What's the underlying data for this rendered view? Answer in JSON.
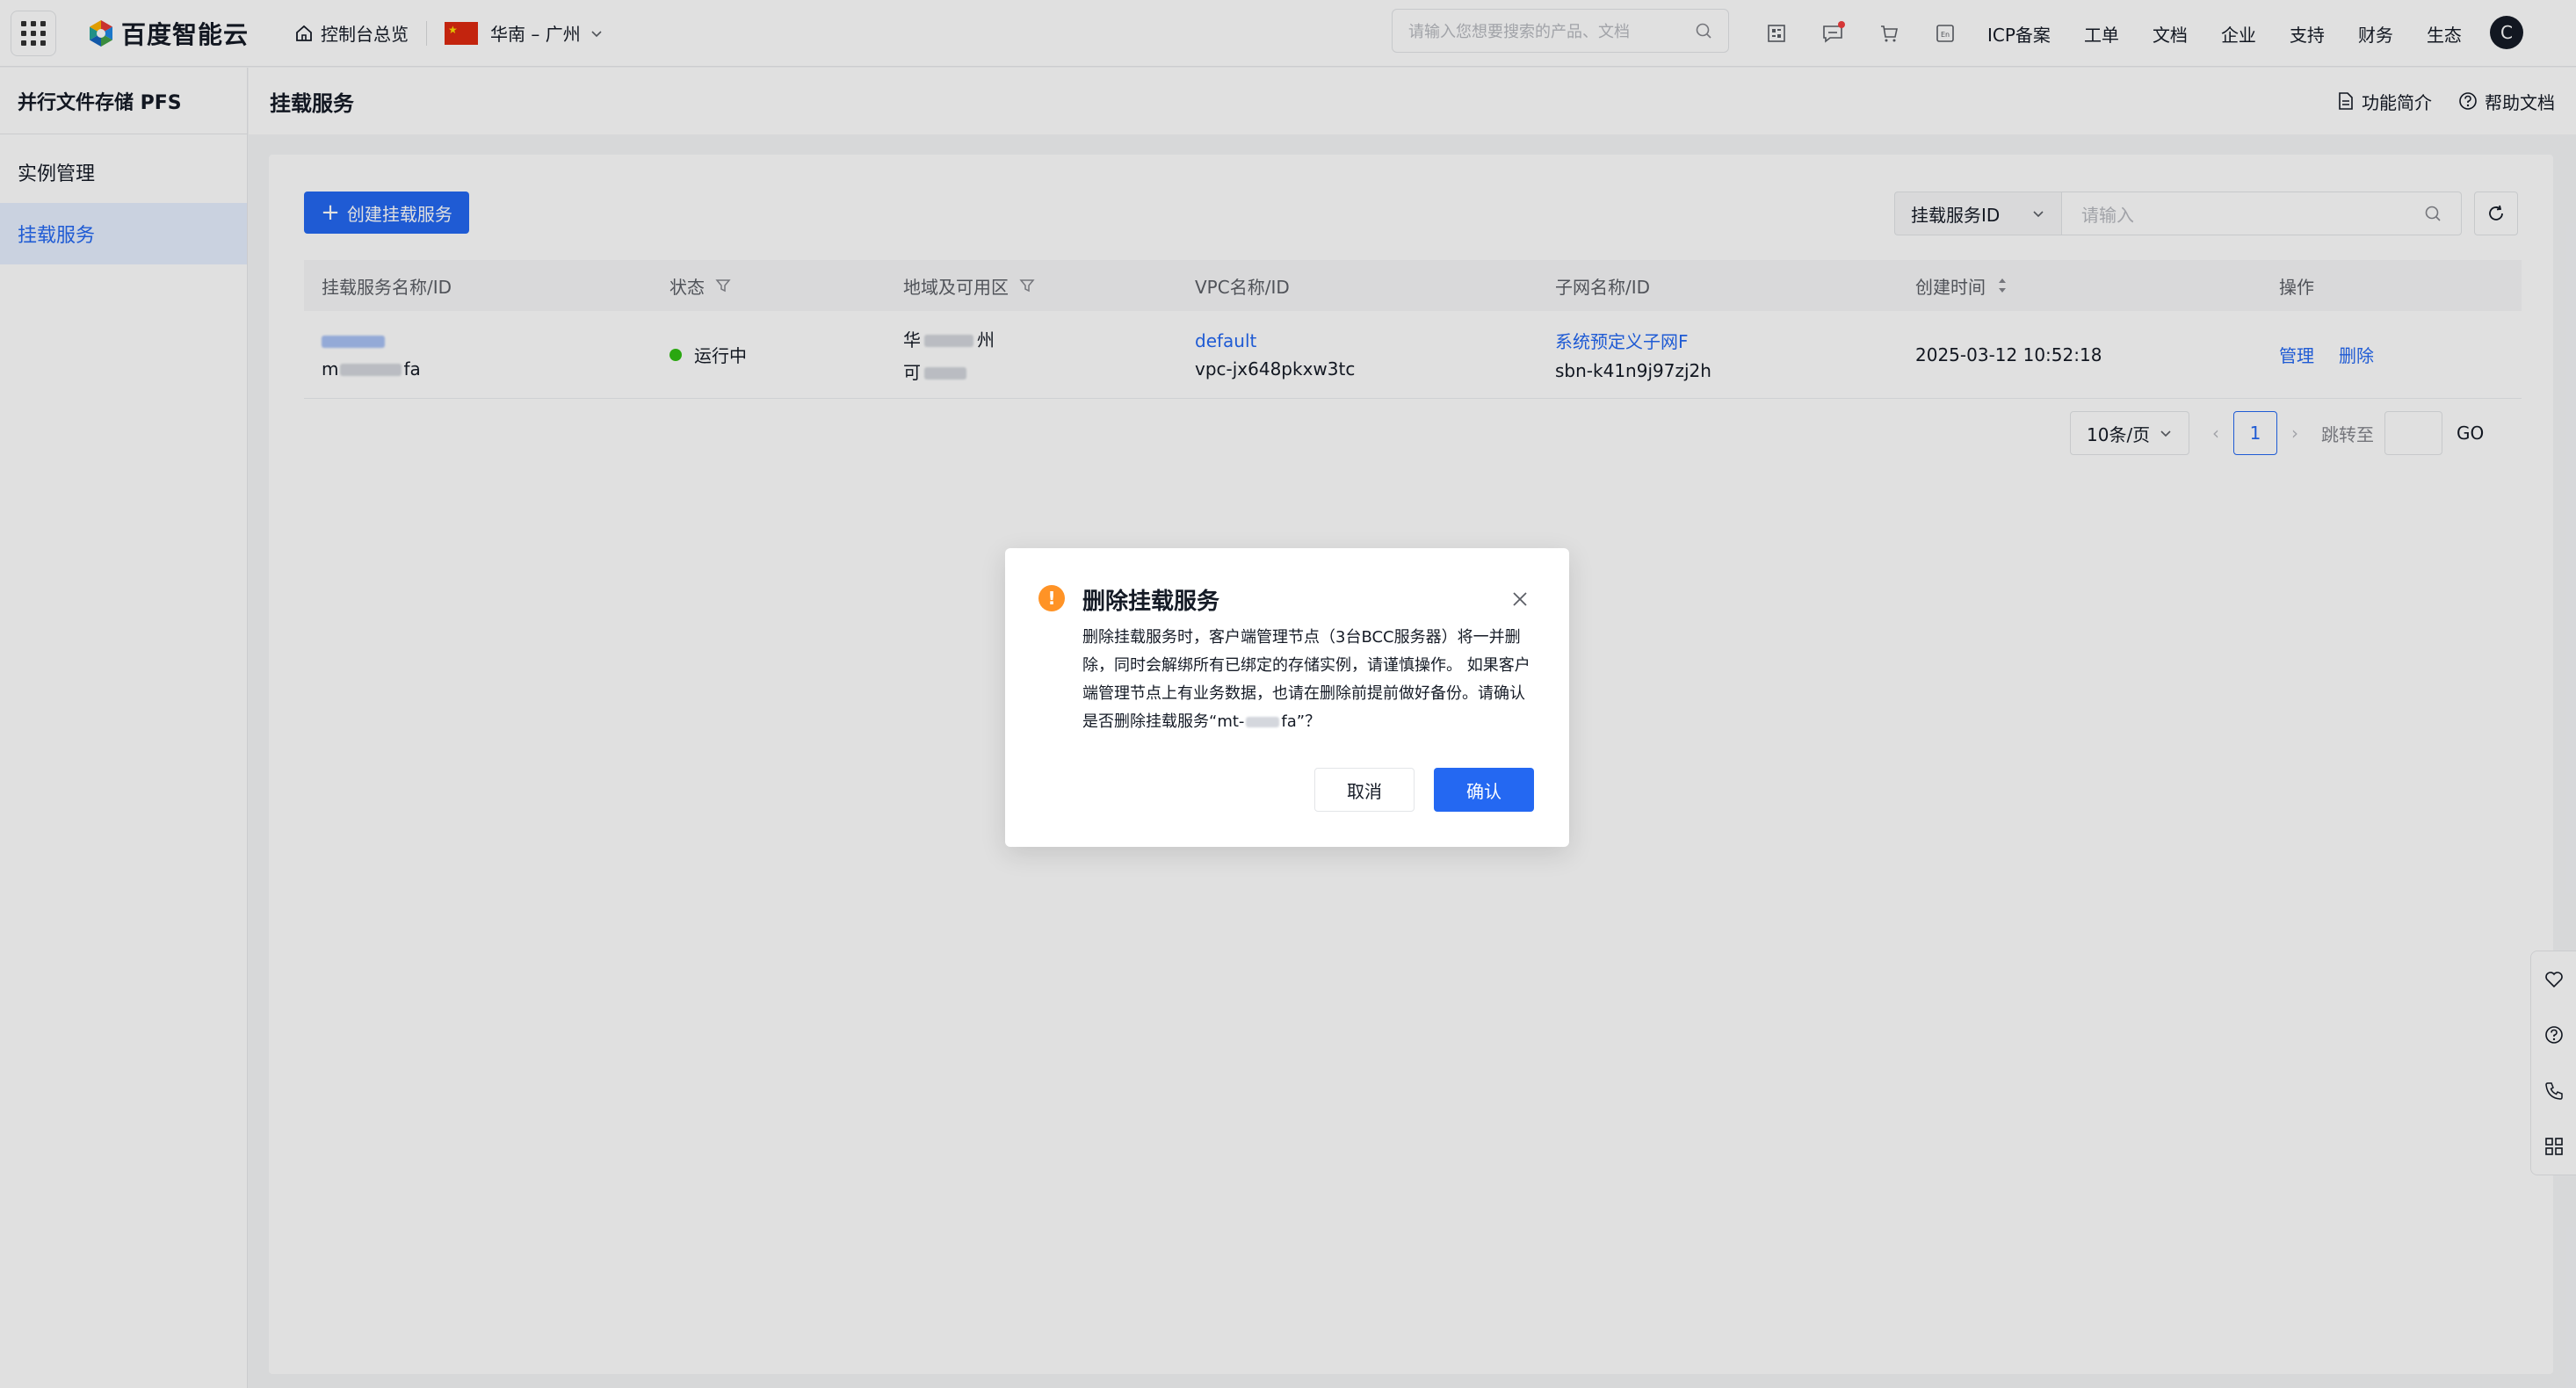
{
  "topbar": {
    "logo_text": "百度智能云",
    "console_link": "控制台总览",
    "region": "华南 – 广州",
    "search_placeholder": "请输入您想要搜索的产品、文档",
    "menu": [
      "ICP备案",
      "工单",
      "文档",
      "企业",
      "支持",
      "财务",
      "生态"
    ],
    "avatar_initial": "C"
  },
  "sidebar": {
    "title": "并行文件存储 PFS",
    "items": [
      {
        "label": "实例管理",
        "active": false
      },
      {
        "label": "挂载服务",
        "active": true
      }
    ]
  },
  "page": {
    "title": "挂载服务",
    "intro_link": "功能简介",
    "help_link": "帮助文档"
  },
  "toolbar": {
    "create_label": "创建挂载服务",
    "filter_field": "挂载服务ID",
    "search_placeholder": "请输入"
  },
  "table": {
    "headers": [
      "挂载服务名称/ID",
      "状态",
      "地域及可用区",
      "VPC名称/ID",
      "子网名称/ID",
      "创建时间",
      "操作"
    ],
    "rows": [
      {
        "name": "",
        "id_start": "m",
        "id_end": "fa",
        "status": "运行中",
        "region": "华",
        "region_end": "州",
        "zone": "可",
        "vpc_name": "default",
        "vpc_id": "vpc-jx648pkxw3tc",
        "subnet_name": "系统预定义子网F",
        "subnet_id": "sbn-k41n9j97zj2h",
        "created": "2025-03-12 10:52:18",
        "actions": [
          "管理",
          "删除"
        ]
      }
    ]
  },
  "pagination": {
    "page_size": "10条/页",
    "current_page": "1",
    "jump_label": "跳转至",
    "go_label": "GO"
  },
  "modal": {
    "title": "删除挂载服务",
    "body": "删除挂载服务时，客户端管理节点（3台BCC服务器）将一并删除，同时会解绑所有已绑定的存储实例，请谨慎操作。 如果客户端管理节点上有业务数据，也请在删除前提前做好备份。请确认是否删除挂载服务“mt-",
    "body_end": "fa”？",
    "cancel_label": "取消",
    "confirm_label": "确认"
  },
  "colors": {
    "primary": "#2468f2",
    "success": "#30bf13",
    "warning": "#ff9326"
  }
}
